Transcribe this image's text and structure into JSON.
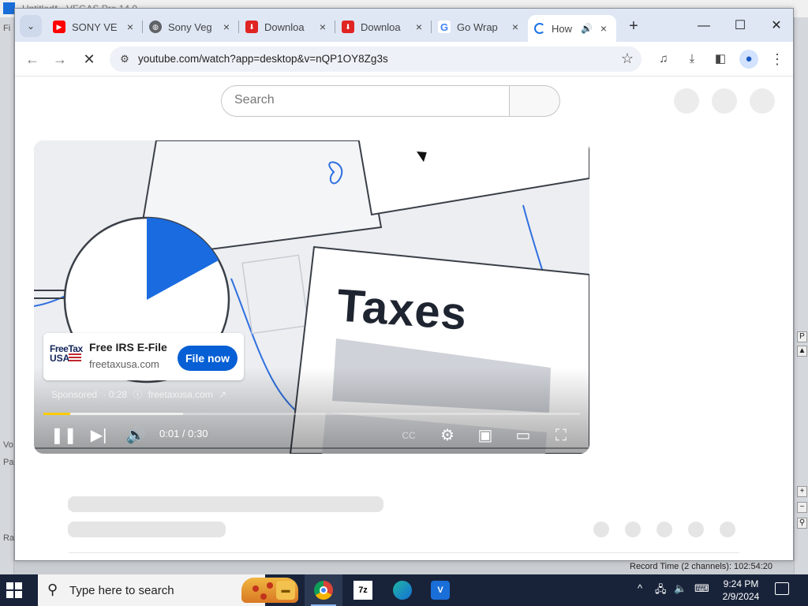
{
  "window": {
    "tabs": [
      {
        "title": "SONY VE",
        "favicon": "youtube-favicon",
        "color": "#ff0000"
      },
      {
        "title": "Sony Veg",
        "favicon": "globe-favicon",
        "color": "#5f6368"
      },
      {
        "title": "Downloa",
        "favicon": "download-favicon",
        "color": "#e02424"
      },
      {
        "title": "Downloa",
        "favicon": "download-favicon",
        "color": "#e02424"
      },
      {
        "title": "Go Wrap",
        "favicon": "google-favicon",
        "color": "#4285f4"
      },
      {
        "title": "How",
        "favicon": "loading-spinner",
        "color": "#1a73e8",
        "active": true
      }
    ],
    "newtab_label": "+",
    "minimize": "—",
    "maximize": "☐",
    "close": "✕"
  },
  "toolbar": {
    "url": "youtube.com/watch?app=desktop&v=nQP1OY8Zg3s"
  },
  "youtube": {
    "search_placeholder": "Search"
  },
  "video": {
    "headline": "Taxes",
    "ad": {
      "logo_line1": "FreeTax",
      "logo_line2": "USA",
      "title": "Free IRS E-File",
      "domain": "freetaxusa.com",
      "cta": "File now"
    },
    "meta": {
      "sponsored": "Sponsored",
      "countdown": "· 0:28",
      "info_icon": "ⓘ",
      "domain": "freetaxusa.com"
    },
    "time": "0:01 / 0:30",
    "progress_fraction": 0.05,
    "buffered_fraction": 0.26,
    "pie_fraction": 0.17,
    "accent": "#1a6be0"
  },
  "background_app": {
    "title": "Untitled* - VEGAS Pro 14.0",
    "menu_text": "Fi",
    "record_time": "Record Time (2 channels): 102:54:20",
    "side_labels": [
      "Vo",
      "Pa",
      "Ra"
    ]
  },
  "taskbar": {
    "search_placeholder": "Type here to search",
    "time": "9:24 PM",
    "date": "2/9/2024",
    "apps": [
      "file-explorer",
      "chrome",
      "7zip",
      "edge",
      "vegas"
    ]
  }
}
